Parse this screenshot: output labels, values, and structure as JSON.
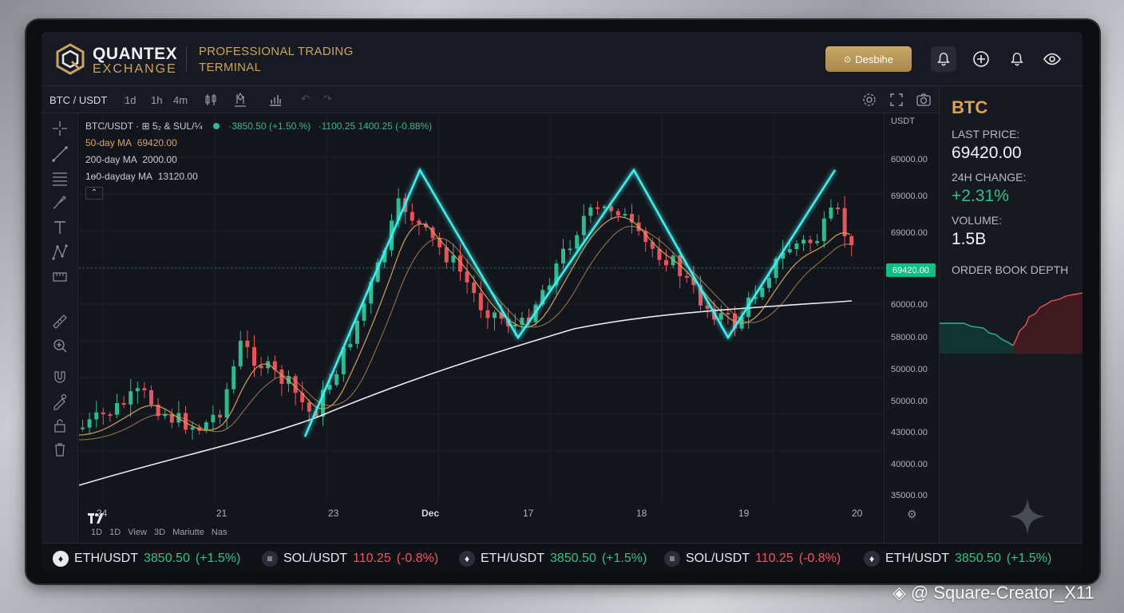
{
  "header": {
    "brand_name": "QUANTEX",
    "brand_sub": "EXCHANGE",
    "tagline_1": "PROFESSIONAL TRADING",
    "tagline_2": "TERMINAL",
    "describe_button": "Desbihe",
    "icons": [
      "bell-icon",
      "plus-circle-icon",
      "bell-icon",
      "eye-icon"
    ]
  },
  "toolbar": {
    "pair": "BTC / USDT",
    "timeframes": [
      "1d",
      "1h",
      "4m"
    ],
    "icons": [
      "candles-icon",
      "indicators-icon",
      "bars-icon",
      "undo-icon",
      "redo-icon",
      "settings-icon",
      "fullscreen-icon",
      "camera-icon"
    ]
  },
  "left_tools": [
    "crosshair-icon",
    "trendline-icon",
    "fib-icon",
    "brush-icon",
    "text-icon",
    "pattern-icon",
    "measure-icon",
    "ruler-icon",
    "zoom-icon",
    "magnet-icon",
    "lock-draw-icon",
    "lock-icon",
    "trash-icon"
  ],
  "legend": {
    "main": "BTC/USDT · ⊞ 5₂ & SUL/¼",
    "main_quote": "·3850.50 (+1.50.%)",
    "main_quote2": "·1100.25  1400.25 (-0.88%)",
    "ma50_label": "50-day MA",
    "ma50_value": "69420.00",
    "ma200_label": "200-day MA",
    "ma200_value": "2000.00",
    "ma100_label": "1ѳ0-dayday MA",
    "ma100_value": "13120.00"
  },
  "chart_data": {
    "type": "candlestick",
    "pair": "BTC/USDT",
    "yaxis_unit": "USDT",
    "y_ticks": [
      "60000.00",
      "69000.00",
      "69000.00",
      "60000.00",
      "58000.00",
      "50000.00",
      "50000.00",
      "43000.00",
      "40000.00",
      "35000.00"
    ],
    "x_ticks": [
      "24",
      "21",
      "23",
      "Dec",
      "17",
      "18",
      "19",
      "20"
    ],
    "last_price_tag": "69420.00",
    "colors": {
      "up": "#2fb98c",
      "down": "#e8545c",
      "pattern": "#3ff0ec",
      "resistance": "#d95cf0",
      "ma_gold": "#d8a45a",
      "ma_white": "#e8eaee"
    }
  },
  "bottom_bar": {
    "items": [
      "1D",
      "1D",
      "View",
      "3D",
      "Mariutte Nas"
    ]
  },
  "right_panel": {
    "symbol": "BTC",
    "last_price_label": "LAST PRICE:",
    "last_price": "69420.00",
    "change_label": "24H CHANGE:",
    "change": "+2.31%",
    "volume_label": "VOLUME:",
    "volume": "1.5B",
    "depth_label": "ORDER BOOK DEPTH"
  },
  "ticker": [
    {
      "sym": "ETH/USDT",
      "price": "3850.50",
      "change": "(+1.5%)",
      "dir": "up",
      "icon": "eth-icon"
    },
    {
      "sym": "SOL/USDT",
      "price": "110.25",
      "change": "(-0.8%)",
      "dir": "dn",
      "icon": "sol-icon"
    },
    {
      "sym": "ETH/USDT",
      "price": "3850.50",
      "change": "(+1.5%)",
      "dir": "up",
      "icon": "eth-icon"
    },
    {
      "sym": "SOL/USDT",
      "price": "110.25",
      "change": "(-0.8%)",
      "dir": "dn",
      "icon": "sol-icon"
    },
    {
      "sym": "ETH/USDT",
      "price": "3850.50",
      "change": "(+1.5%)",
      "dir": "up",
      "icon": "eth-icon"
    }
  ],
  "watermark": "@ Square-Creator_X11"
}
